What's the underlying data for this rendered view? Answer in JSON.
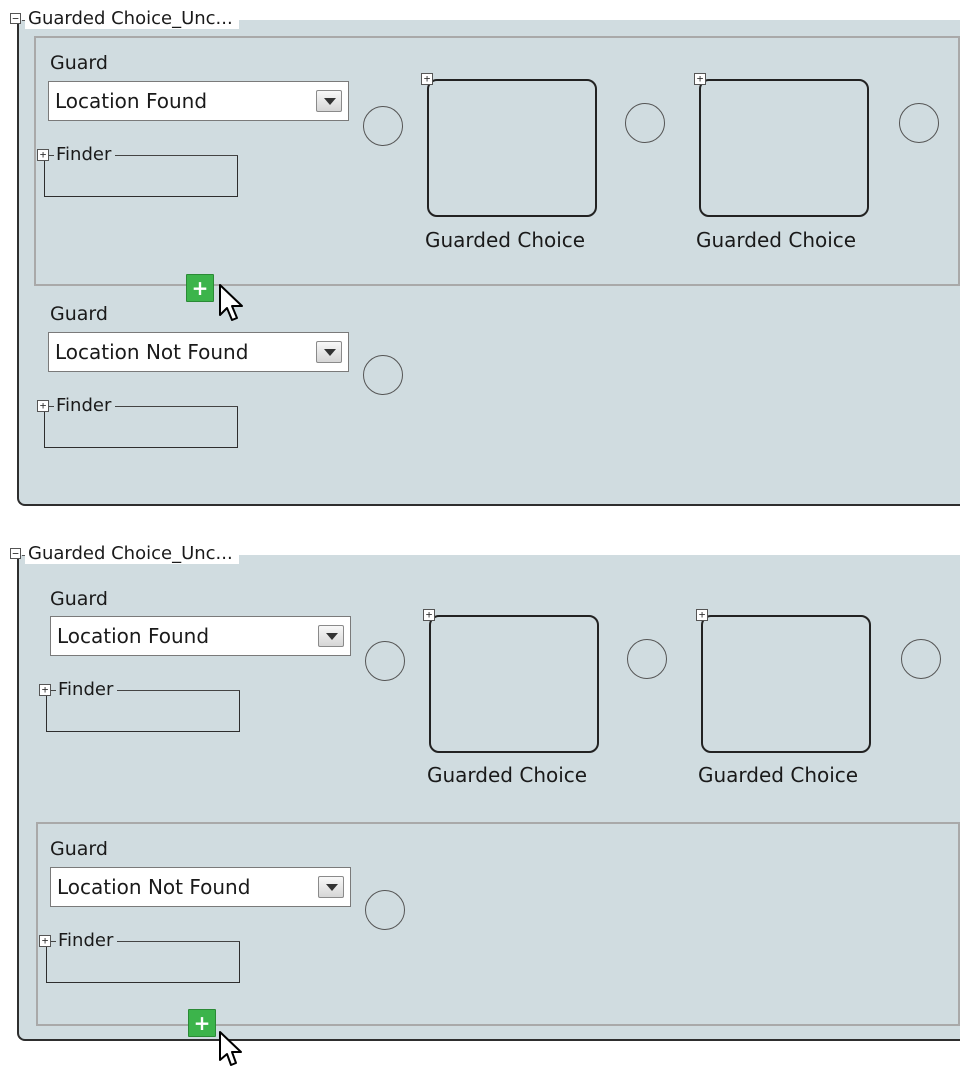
{
  "panels": [
    {
      "title": "Guarded Choice_Unc...",
      "collapse_glyph": "−",
      "branches": [
        {
          "guard_label": "Guard",
          "guard_value": "Location Found",
          "finder_label": "Finder",
          "choices": [
            {
              "label": "Guarded Choice"
            },
            {
              "label": "Guarded Choice"
            }
          ]
        },
        {
          "guard_label": "Guard",
          "guard_value": "Location Not Found",
          "finder_label": "Finder",
          "choices": []
        }
      ],
      "add_label": "+",
      "highlighted_branch": 1
    },
    {
      "title": "Guarded Choice_Unc...",
      "collapse_glyph": "−",
      "branches": [
        {
          "guard_label": "Guard",
          "guard_value": "Location Found",
          "finder_label": "Finder",
          "choices": [
            {
              "label": "Guarded Choice"
            },
            {
              "label": "Guarded Choice"
            }
          ]
        },
        {
          "guard_label": "Guard",
          "guard_value": "Location Not Found",
          "finder_label": "Finder",
          "choices": []
        }
      ],
      "add_label": "+",
      "highlighted_branch": 2
    }
  ],
  "expand_glyph": "+",
  "icons": {
    "collapse": "collapse-icon",
    "expand": "expand-icon",
    "dropdown": "chevron-down-icon",
    "add": "plus-icon",
    "cursor": "mouse-pointer-icon"
  },
  "colors": {
    "panel_background": "#d0dce0",
    "highlight_border": "#a9a9a9",
    "add_button": "#3cb44b"
  }
}
